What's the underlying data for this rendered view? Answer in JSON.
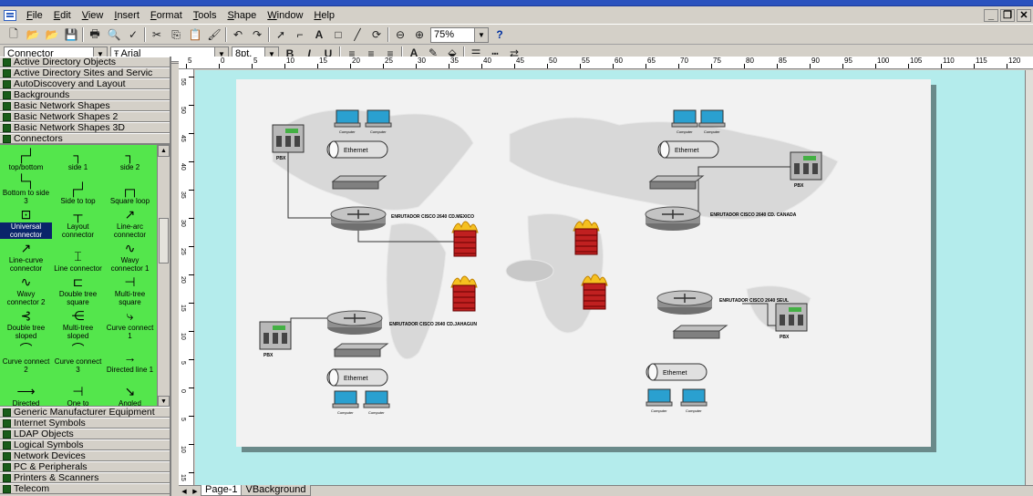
{
  "menubar": {
    "items": [
      "File",
      "Edit",
      "View",
      "Insert",
      "Format",
      "Tools",
      "Shape",
      "Window",
      "Help"
    ]
  },
  "toolbar": {
    "zoom_value": "75%",
    "help_glyph": "?"
  },
  "format_toolbar": {
    "style_value": "Connector",
    "font_value": "Arial",
    "size_value": "8pt."
  },
  "stencils_top": [
    "Active Directory Objects",
    "Active Directory Sites and Servic",
    "AutoDiscovery and Layout",
    "Backgrounds",
    "Basic Network Shapes",
    "Basic Network Shapes 2",
    "Basic Network Shapes 3D",
    "Connectors"
  ],
  "connector_palette": [
    {
      "label": "top/bottom",
      "icon": "connector-top-bottom-icon",
      "glyph": "┌┘"
    },
    {
      "label": "side 1",
      "icon": "connector-side1-icon",
      "glyph": "┐"
    },
    {
      "label": "side 2",
      "icon": "connector-side2-icon",
      "glyph": "┐"
    },
    {
      "label": "Bottom to side 3",
      "icon": "connector-bottom-side-icon",
      "glyph": "└┐"
    },
    {
      "label": "Side to top",
      "icon": "connector-side-top-icon",
      "glyph": "┌┘"
    },
    {
      "label": "Square loop",
      "icon": "connector-square-loop-icon",
      "glyph": "┌┐"
    },
    {
      "label": "Universal connector",
      "icon": "universal-connector-icon",
      "glyph": "⊡",
      "selected": true
    },
    {
      "label": "Layout connector",
      "icon": "layout-connector-icon",
      "glyph": "┬"
    },
    {
      "label": "Line-arc connector",
      "icon": "line-arc-connector-icon",
      "glyph": "↗"
    },
    {
      "label": "Line-curve connector",
      "icon": "line-curve-connector-icon",
      "glyph": "↗"
    },
    {
      "label": "Line connector",
      "icon": "line-connector-icon",
      "glyph": "⌶"
    },
    {
      "label": "Wavy connector 1",
      "icon": "wavy-connector-icon",
      "glyph": "∿"
    },
    {
      "label": "Wavy connector 2",
      "icon": "wavy-connector-2-icon",
      "glyph": "∿"
    },
    {
      "label": "Double tree square",
      "icon": "double-tree-square-icon",
      "glyph": "⊏"
    },
    {
      "label": "Multi-tree square",
      "icon": "multi-tree-square-icon",
      "glyph": "⊣"
    },
    {
      "label": "Double tree sloped",
      "icon": "double-tree-sloped-icon",
      "glyph": "⊰"
    },
    {
      "label": "Multi-tree sloped",
      "icon": "multi-tree-sloped-icon",
      "glyph": "⋲"
    },
    {
      "label": "Curve connect 1",
      "icon": "curve-connect-1-icon",
      "glyph": "⤷"
    },
    {
      "label": "Curve connect 2",
      "icon": "curve-connect-2-icon",
      "glyph": "⌒"
    },
    {
      "label": "Curve connect 3",
      "icon": "curve-connect-3-icon",
      "glyph": "⌒"
    },
    {
      "label": "Directed line 1",
      "icon": "directed-line-1-icon",
      "glyph": "→"
    },
    {
      "label": "Directed",
      "icon": "directed-line-2-icon",
      "glyph": "⟶"
    },
    {
      "label": "One to",
      "icon": "one-to-many-icon",
      "glyph": "⊣"
    },
    {
      "label": "Angled",
      "icon": "angled-connector-icon",
      "glyph": "↘"
    }
  ],
  "stencils_bottom": [
    "Generic Manufacturer Equipment",
    "Internet Symbols",
    "LDAP Objects",
    "Logical Symbols",
    "Network Devices",
    "PC & Peripherals",
    "Printers & Scanners",
    "Telecom"
  ],
  "ruler": {
    "h_labels": [
      "5",
      "0",
      "5",
      "10",
      "15",
      "20",
      "25",
      "30",
      "35",
      "40",
      "45",
      "50",
      "55",
      "60",
      "65",
      "70",
      "75",
      "80",
      "85",
      "90",
      "95",
      "100",
      "105",
      "110",
      "115",
      "120"
    ],
    "v_labels": [
      "55",
      "50",
      "45",
      "40",
      "35",
      "30",
      "25",
      "20",
      "15",
      "10",
      "5",
      "0",
      "5",
      "10",
      "15"
    ]
  },
  "diagram": {
    "routers": [
      {
        "label": "ENRUTADOR CISCO 2640 CD.MEXICO"
      },
      {
        "label": "ENRUTADOR CISCO 2640 CD. CANADA"
      },
      {
        "label": "ENRUTADOR CISCO 2640 CD.JAHAGUN"
      },
      {
        "label": "ENRUTADOR CISCO 2640 SEUL"
      }
    ],
    "pbx_label": "PBX",
    "ethernet_label": "Ethernet",
    "computer_label": "Computer"
  },
  "tabs": [
    "Page-1",
    "VBackground"
  ],
  "colors": {
    "palette_bg": "#54e64c",
    "canvas_bg": "#b4ecec",
    "selection": "#0a246a"
  }
}
